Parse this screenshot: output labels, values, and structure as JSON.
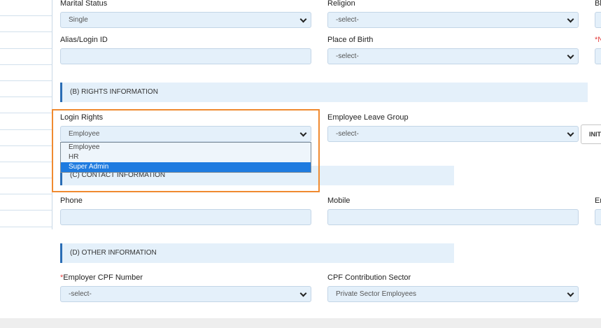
{
  "personal": {
    "marital_status": {
      "label": "Marital Status",
      "value": "Single"
    },
    "religion": {
      "label": "Religion",
      "value": "-select-"
    },
    "third_col_label_1": "Bl",
    "alias": {
      "label": "Alias/Login ID",
      "value": ""
    },
    "place_of_birth": {
      "label": "Place of Birth",
      "value": "-select-"
    },
    "third_col_label_2": "*N"
  },
  "rights": {
    "section_title": "(B) RIGHTS INFORMATION",
    "login_rights": {
      "label": "Login Rights",
      "value": "Employee",
      "options": [
        "Employee",
        "HR",
        "Super Admin"
      ],
      "selected_index": 2
    },
    "leave_group": {
      "label": "Employee Leave Group",
      "value": "-select-"
    },
    "init_button": "INIT"
  },
  "contact": {
    "section_title": "(C) CONTACT INFORMATION",
    "phone": {
      "label": "Phone",
      "value": ""
    },
    "mobile": {
      "label": "Mobile",
      "value": ""
    },
    "third_col_label": "Em"
  },
  "other": {
    "section_title": "(D) OTHER INFORMATION",
    "cpf_number": {
      "label": "Employer CPF Number",
      "required_mark": "*",
      "value": "-select-"
    },
    "cpf_sector": {
      "label": "CPF Contribution Sector",
      "value": "Private Sector Employees"
    }
  },
  "colors": {
    "field_bg": "#e4f0fa",
    "section_accent": "#2a6db5",
    "highlight_box": "#f08a30",
    "selected_option": "#1e7be0"
  }
}
